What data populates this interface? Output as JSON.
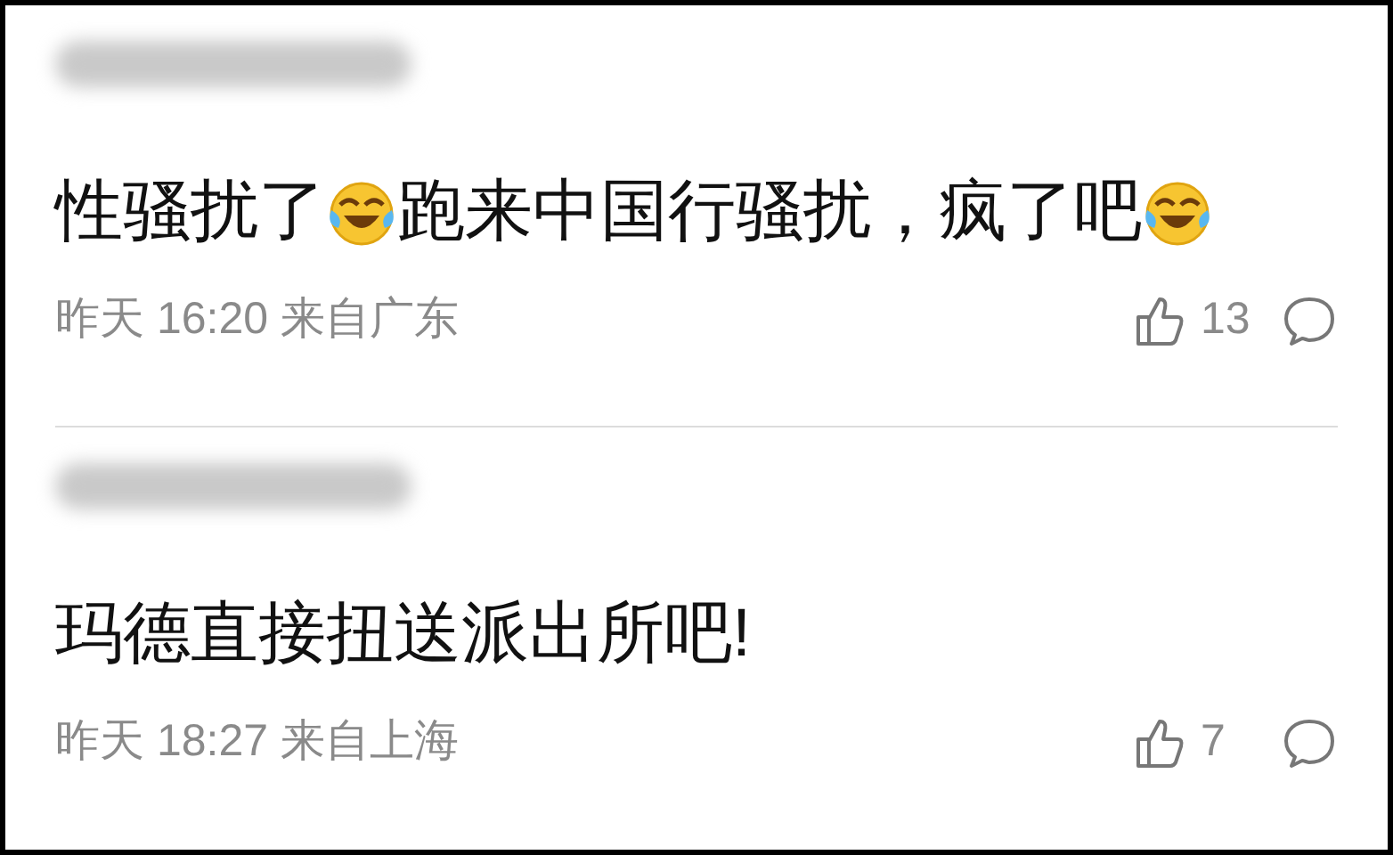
{
  "comments": [
    {
      "parts": [
        {
          "kind": "text",
          "text": "性骚扰了"
        },
        {
          "kind": "emoji"
        },
        {
          "kind": "text",
          "text": "跑来中国行骚扰，疯了吧"
        },
        {
          "kind": "emoji"
        }
      ],
      "time": "昨天 16:20 来自广东",
      "likes": "13"
    },
    {
      "parts": [
        {
          "kind": "text",
          "text": "玛德直接扭送派出所吧!"
        }
      ],
      "time": "昨天 18:27 来自上海",
      "likes": "7"
    }
  ]
}
